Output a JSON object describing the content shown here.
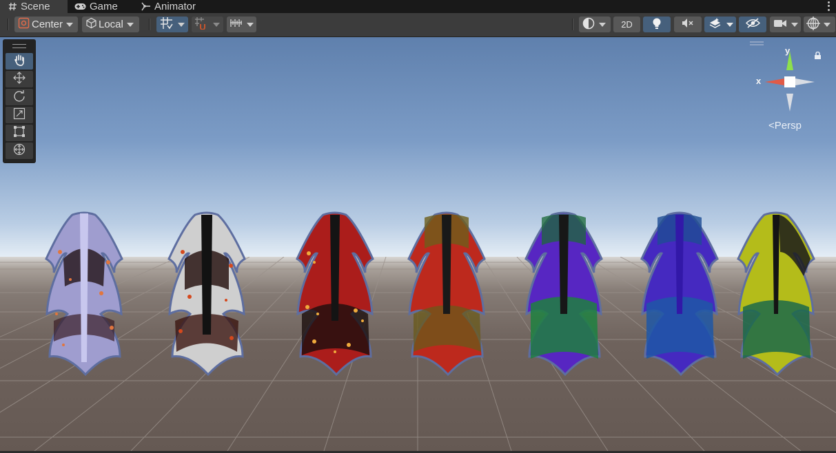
{
  "tabs": [
    {
      "label": "Scene",
      "icon": "hash-icon"
    },
    {
      "label": "Game",
      "icon": "gamepad-icon"
    },
    {
      "label": "Animator",
      "icon": "animator-icon"
    }
  ],
  "toolbar": {
    "pivot_label": "Center",
    "space_label": "Local",
    "mode_2d_label": "2D"
  },
  "gizmo": {
    "y_label": "y",
    "x_label": "x",
    "projection_label": "Persp"
  },
  "tool_palette": [
    "hand-icon",
    "move-icon",
    "rotate-icon",
    "scale-icon",
    "rect-icon",
    "transform-icon"
  ],
  "scene_objects": [
    {
      "name": "tail-lavender",
      "colors": [
        "#a3a1d8",
        "#1b1b1b",
        "#d6703a"
      ]
    },
    {
      "name": "tail-silver",
      "colors": [
        "#d8d8d8",
        "#141414",
        "#c2451c"
      ]
    },
    {
      "name": "tail-red-gold",
      "colors": [
        "#b21f1c",
        "#141414",
        "#e8a23a"
      ]
    },
    {
      "name": "tail-red-olive",
      "colors": [
        "#c02a1e",
        "#1a1a1a",
        "#7c6a1e"
      ]
    },
    {
      "name": "tail-purple-green",
      "colors": [
        "#5a28c8",
        "#1a1a1a",
        "#1f7f3e"
      ]
    },
    {
      "name": "tail-violet-blue",
      "colors": [
        "#4a2cc4",
        "#1c1c2a",
        "#1f56a6"
      ]
    },
    {
      "name": "tail-lime",
      "colors": [
        "#b7bf1c",
        "#1b1b1b",
        "#1d6a4a"
      ]
    }
  ],
  "colors": {
    "toolbar_bg": "#3c3c3c",
    "button_bg": "#585858",
    "selected_bg": "#46607c",
    "sky_top": "#5f80ad",
    "ground": "#6e625c"
  }
}
